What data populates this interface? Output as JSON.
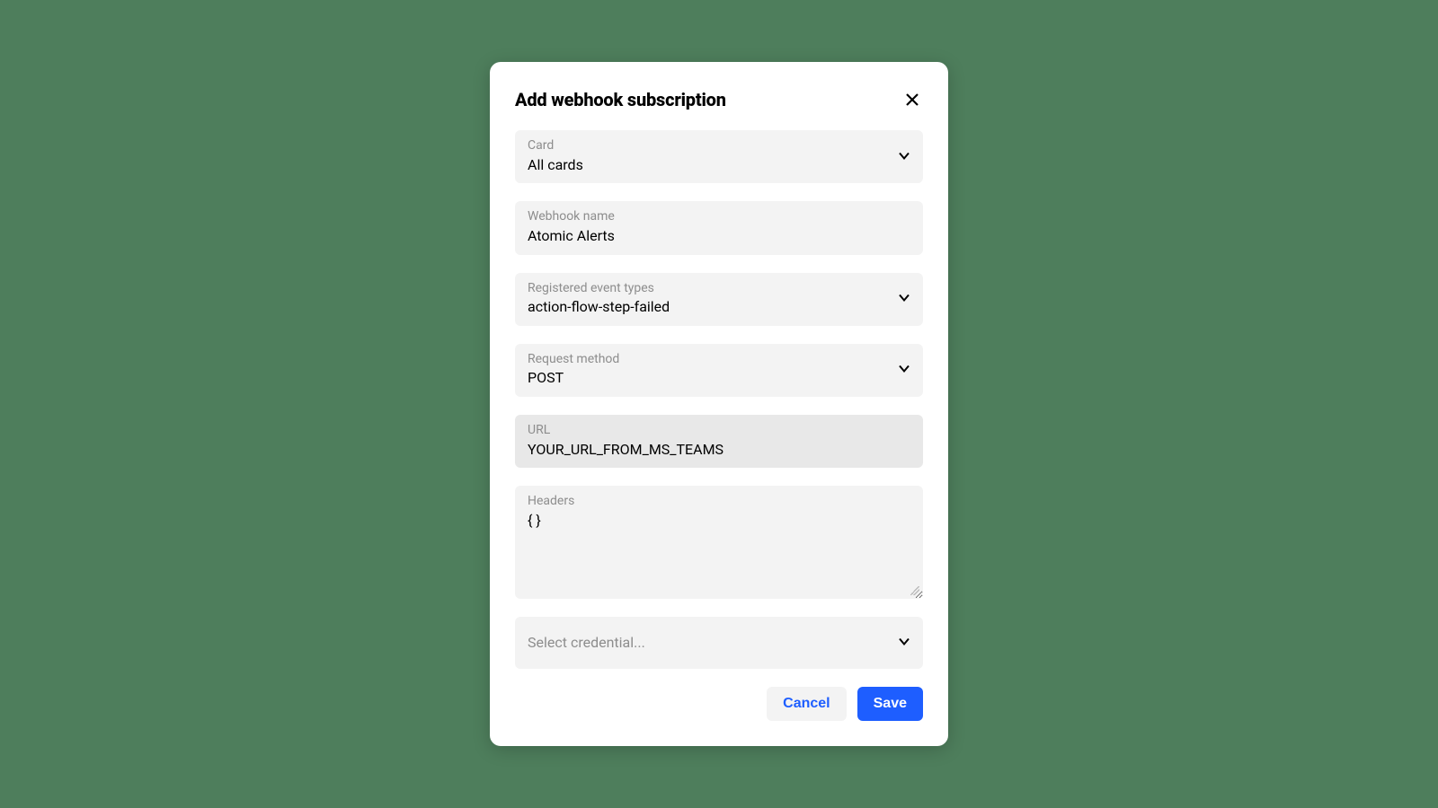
{
  "dialog": {
    "title": "Add webhook subscription",
    "fields": {
      "card": {
        "label": "Card",
        "value": "All cards"
      },
      "webhook_name": {
        "label": "Webhook name",
        "value": "Atomic Alerts"
      },
      "event_types": {
        "label": "Registered event types",
        "value": "action-flow-step-failed"
      },
      "request_method": {
        "label": "Request method",
        "value": "POST"
      },
      "url": {
        "label": "URL",
        "value": "YOUR_URL_FROM_MS_TEAMS"
      },
      "headers": {
        "label": "Headers",
        "value": "{ }"
      },
      "credential": {
        "placeholder": "Select credential..."
      }
    },
    "buttons": {
      "cancel": "Cancel",
      "save": "Save"
    }
  }
}
